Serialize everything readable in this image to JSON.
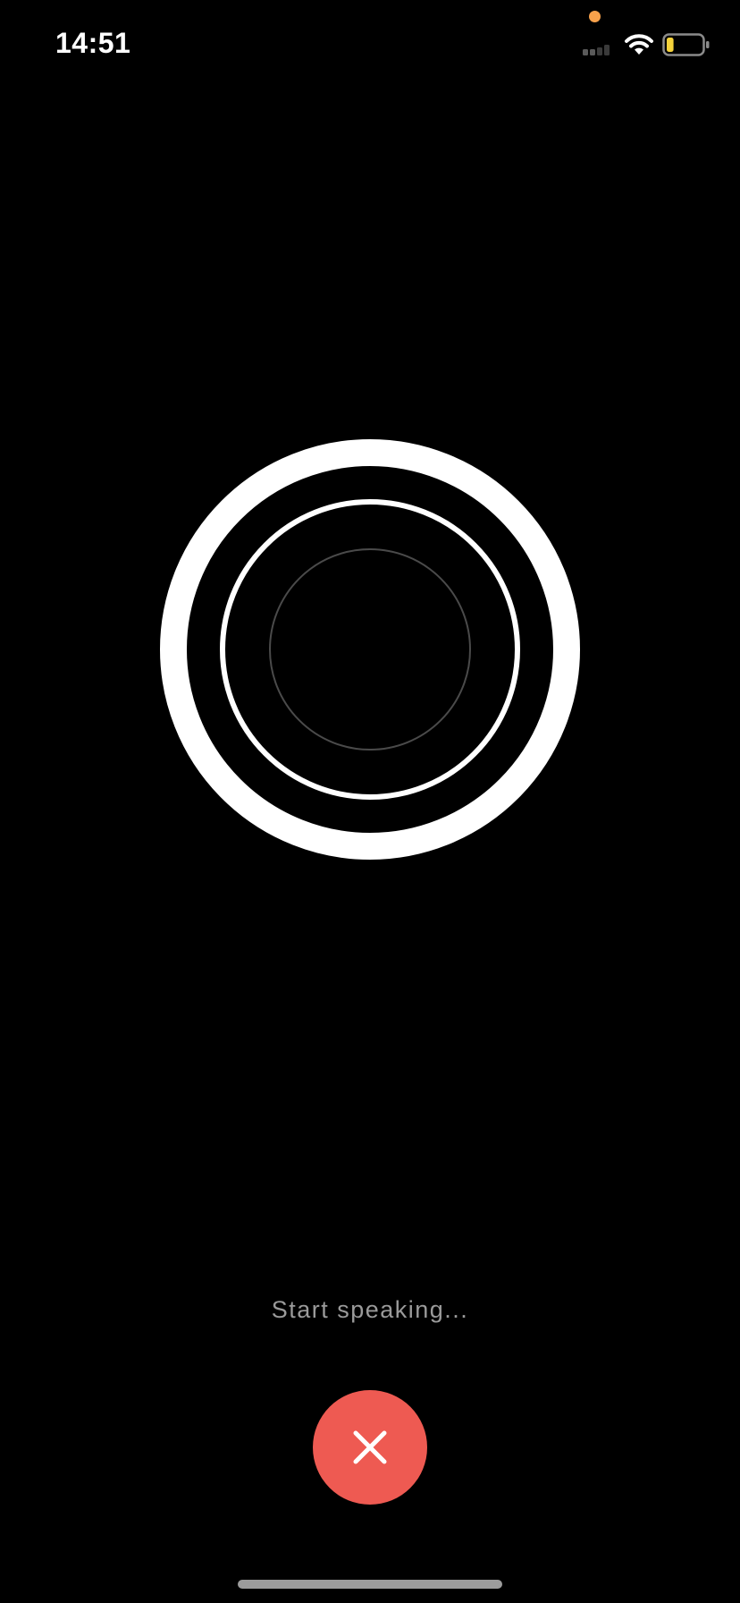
{
  "status_bar": {
    "time": "14:51",
    "icons": {
      "privacy_indicator": "orange-dot-icon",
      "signal": "cellular-signal-icon",
      "wifi": "wifi-icon",
      "battery": "battery-icon"
    },
    "battery_level": 0.2
  },
  "visualizer": {
    "icon": "voice-visualizer-rings"
  },
  "prompt": {
    "text": "Start speaking..."
  },
  "cancel_button": {
    "icon": "close-icon"
  },
  "colors": {
    "background": "#000000",
    "accent_red": "#EE5A52",
    "privacy_orange": "#F7A14B",
    "battery_yellow": "#F5D23A",
    "prompt_gray": "#9A9A9A"
  }
}
